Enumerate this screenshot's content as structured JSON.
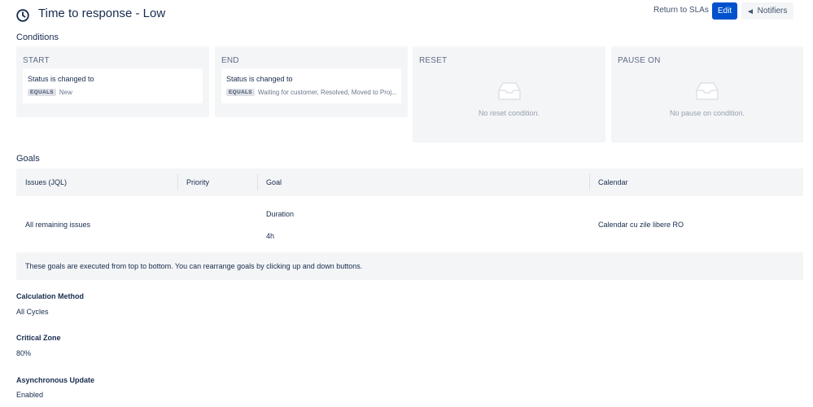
{
  "header": {
    "title": "Time to response - Low",
    "return_label": "Return to SLAs",
    "edit_label": "Edit",
    "notifiers_label": "Notifiers"
  },
  "conditions": {
    "heading": "Conditions",
    "start": {
      "title": "START",
      "text": "Status is changed to",
      "operator": "EQUALS",
      "values": "New"
    },
    "end": {
      "title": "END",
      "text": "Status is changed to",
      "operator": "EQUALS",
      "values": "Waiting for customer, Resolved, Moved to Proj..."
    },
    "reset": {
      "title": "RESET",
      "empty_text": "No reset condition."
    },
    "pause": {
      "title": "PAUSE ON",
      "empty_text": "No pause on condition."
    }
  },
  "goals": {
    "heading": "Goals",
    "columns": [
      "Issues (JQL)",
      "Priority",
      "Goal",
      "Calendar"
    ],
    "row": {
      "issues": "All remaining issues",
      "priority": "",
      "goal_label": "Duration",
      "goal_value": "4h",
      "calendar": "Calendar cu zile libere RO"
    },
    "note": "These goals are executed from top to bottom. You can rearrange goals by clicking up and down buttons."
  },
  "settings": {
    "calculation_method": {
      "label": "Calculation Method",
      "value": "All Cycles"
    },
    "critical_zone": {
      "label": "Critical Zone",
      "value": "80%"
    },
    "async_update": {
      "label": "Asynchronous Update",
      "value": "Enabled"
    }
  },
  "icons": {
    "title_icon": "clock-icon",
    "notifiers_icon": "megaphone-icon",
    "empty_icon": "empty-inbox-icon"
  },
  "colors": {
    "primary": "#0052cc",
    "panel_bg": "#f4f5f7",
    "text": "#172b4d",
    "muted": "#97a0af"
  }
}
